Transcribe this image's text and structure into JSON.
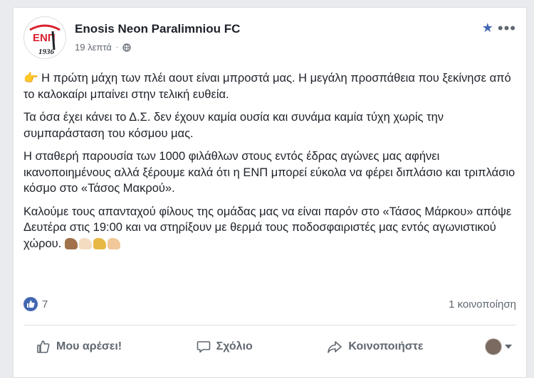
{
  "post": {
    "page_name": "Enosis Neon Paralimniou FC",
    "timestamp": "19 λεπτά",
    "logo_text": "ENΠ",
    "logo_year": "1936",
    "paragraphs": [
      "Η πρώτη μάχη των πλέι αουτ είναι μπροστά μας. Η μεγάλη προσπάθεια που ξεκίνησε από το καλοκαίρι μπαίνει στην τελική ευθεία.",
      "Τα όσα έχει κάνει το Δ.Σ. δεν έχουν καμία ουσία και συνάμα καμία τύχη χωρίς την συμπαράσταση του κόσμου μας.",
      "Η σταθερή παρουσία των 1000 φιλάθλων στους εντός έδρας αγώνες μας αφήνει ικανοποιημένους αλλά ξέρουμε καλά ότι η ΕΝΠ μπορεί εύκολα να φέρει διπλάσιο και τριπλάσιο κόσμο στο «Τάσος Μακρού».",
      "Καλούμε τους απανταχού φίλους της ομάδας μας να είναι παρόν στο «Τάσος Μάρκου» απόψε Δευτέρα στις 19:00 και να στηρίξουν με θερμά τους ποδοσφαιριστές μας εντός αγωνιστικού χώρου."
    ],
    "lead_emoji": "👉",
    "muscle_colors": [
      "#a0714a",
      "#f3dcc0",
      "#e8b844",
      "#f0c89a"
    ]
  },
  "stats": {
    "likes": "7",
    "shares": "1 κοινοποίηση"
  },
  "actions": {
    "like_label": "Μου αρέσει!",
    "comment_label": "Σχόλιο",
    "share_label": "Κοινοποιήστε"
  },
  "colors": {
    "accent": "#4267b2",
    "logo_red": "#d9202e"
  }
}
